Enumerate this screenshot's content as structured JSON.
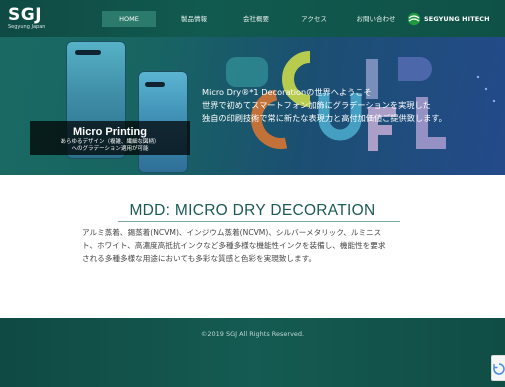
{
  "header": {
    "logo": "SGJ",
    "logo_sub": "Segyung Japan",
    "nav": [
      {
        "label": "HOME",
        "active": true
      },
      {
        "label": "製品情報"
      },
      {
        "label": "会社概要"
      },
      {
        "label": "アクセス"
      },
      {
        "label": "お問い合わせ"
      }
    ],
    "brand": "SEGYUNG HITECH"
  },
  "hero": {
    "lines": [
      "Micro Dry®*1 Decorationの世界へようこそ",
      "世界で初めてスマートフォン加飾にグラデーションを実現した",
      "独自の印刷技術で常に新たな表現力と高付加価値ご提供致します。"
    ],
    "badge_title": "Micro Printing",
    "badge_sub": [
      "あらゆるデザイン（複雑、繊細な図柄）",
      "へのグラデーション適用が可能"
    ]
  },
  "main": {
    "heading": "MDD: MICRO DRY DECORATION",
    "paragraph": [
      "アルミ蒸着、錫蒸着(NCVM)、インジウム蒸着(NCVM)、シルバーメタリック、ルミニス",
      "ト、ホワイト、高濃度高抵抗インクなど多種多様な機能性インクを装備し、機能性を要求",
      "される多種多様な用途においても多彩な質感と色彩を実現致します。"
    ]
  },
  "footer": {
    "copyright": "©2019 SGJ All Rights Reserved."
  },
  "colors": {
    "header_bg": "#115a4f",
    "accent": "#1b5a55",
    "nav_active": "#2c7a6c"
  }
}
